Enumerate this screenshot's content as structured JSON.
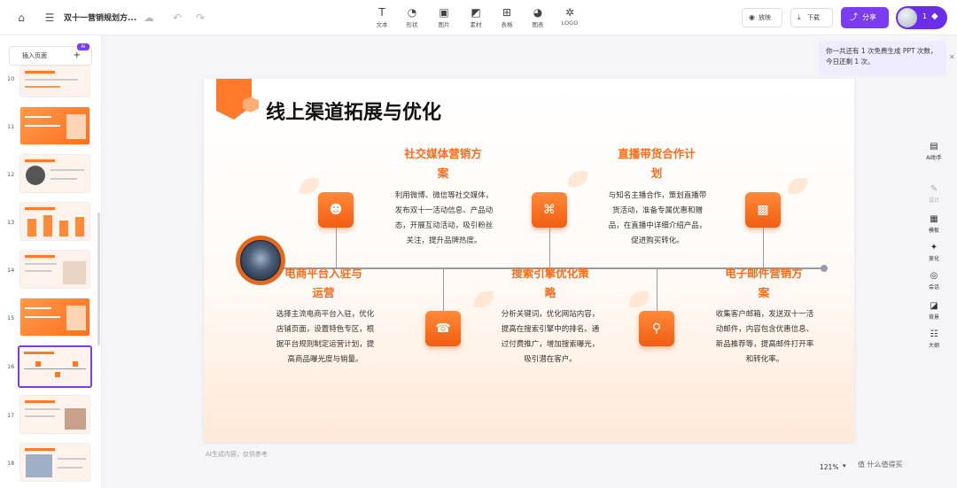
{
  "topbar": {
    "doc_title": "双十一营销规划方...",
    "tools": [
      {
        "label": "文本",
        "icon": "text-icon"
      },
      {
        "label": "形状",
        "icon": "shape-icon"
      },
      {
        "label": "图片",
        "icon": "image-icon"
      },
      {
        "label": "素材",
        "icon": "material-icon"
      },
      {
        "label": "表格",
        "icon": "table-icon"
      },
      {
        "label": "图表",
        "icon": "chart-icon"
      },
      {
        "label": "LOGO",
        "icon": "logo-icon"
      }
    ],
    "present_label": "放映",
    "download_label": "下载",
    "share_label": "分享",
    "user_count": "1"
  },
  "tooltip": {
    "text": "你一共还有 1 次免费生成 PPT 次数，今日还剩 1 次。"
  },
  "sidebar": {
    "insert_label": "插入页面",
    "ai_badge": "AI",
    "slides": [
      {
        "num": "10"
      },
      {
        "num": "11"
      },
      {
        "num": "12"
      },
      {
        "num": "13"
      },
      {
        "num": "14"
      },
      {
        "num": "15"
      },
      {
        "num": "16",
        "selected": true
      },
      {
        "num": "17"
      },
      {
        "num": "18"
      }
    ]
  },
  "slide": {
    "title": "线上渠道拓展与优化",
    "sections": [
      {
        "heading_1": "电商平台入驻与",
        "heading_2": "运营",
        "body": "选择主流电商平台入驻，优化店铺页面，设置特色专区，根据平台规则制定运营计划，提高商品曝光度与销量。",
        "icon": "user-icon"
      },
      {
        "heading_1": "社交媒体营销方",
        "heading_2": "案",
        "body": "利用微博、微信等社交媒体，发布双十一活动信息、产品动态，开展互动活动，吸引粉丝关注，提升品牌热度。",
        "icon": "megaphone-icon"
      },
      {
        "heading_1": "搜索引擎优化策",
        "heading_2": "略",
        "body": "分析关键词，优化网站内容，提高在搜索引擎中的排名。通过付费推广，增加搜索曝光，吸引潜在客户。",
        "icon": "grid-icon"
      },
      {
        "heading_1": "直播带货合作计",
        "heading_2": "划",
        "body": "与知名主播合作，策划直播带货活动，准备专属优惠和赠品，在直播中详细介绍产品，促进购买转化。",
        "icon": "search-icon"
      },
      {
        "heading_1": "电子邮件营销方",
        "heading_2": "案",
        "body": "收集客户邮箱，发送双十一活动邮件，内容包含优惠信息、新品推荐等，提高邮件打开率和转化率。",
        "icon": "bar-chart-icon"
      }
    ]
  },
  "canvas_caption": "AI生成内容，仅供参考",
  "right_panel": [
    {
      "label": "AI助手",
      "icon": "ai-assistant-icon"
    },
    {
      "label": "设计",
      "icon": "design-icon"
    },
    {
      "label": "模板",
      "icon": "template-icon"
    },
    {
      "label": "美化",
      "icon": "beautify-icon"
    },
    {
      "label": "会话",
      "icon": "session-icon"
    },
    {
      "label": "背景",
      "icon": "background-icon"
    },
    {
      "label": "大纲",
      "icon": "outline-icon"
    }
  ],
  "footer": {
    "zoom": "121%",
    "watermark": "值 什么值得买"
  },
  "colors": {
    "accent": "#7b3cf0",
    "brand_orange": "#ff6a1a"
  }
}
